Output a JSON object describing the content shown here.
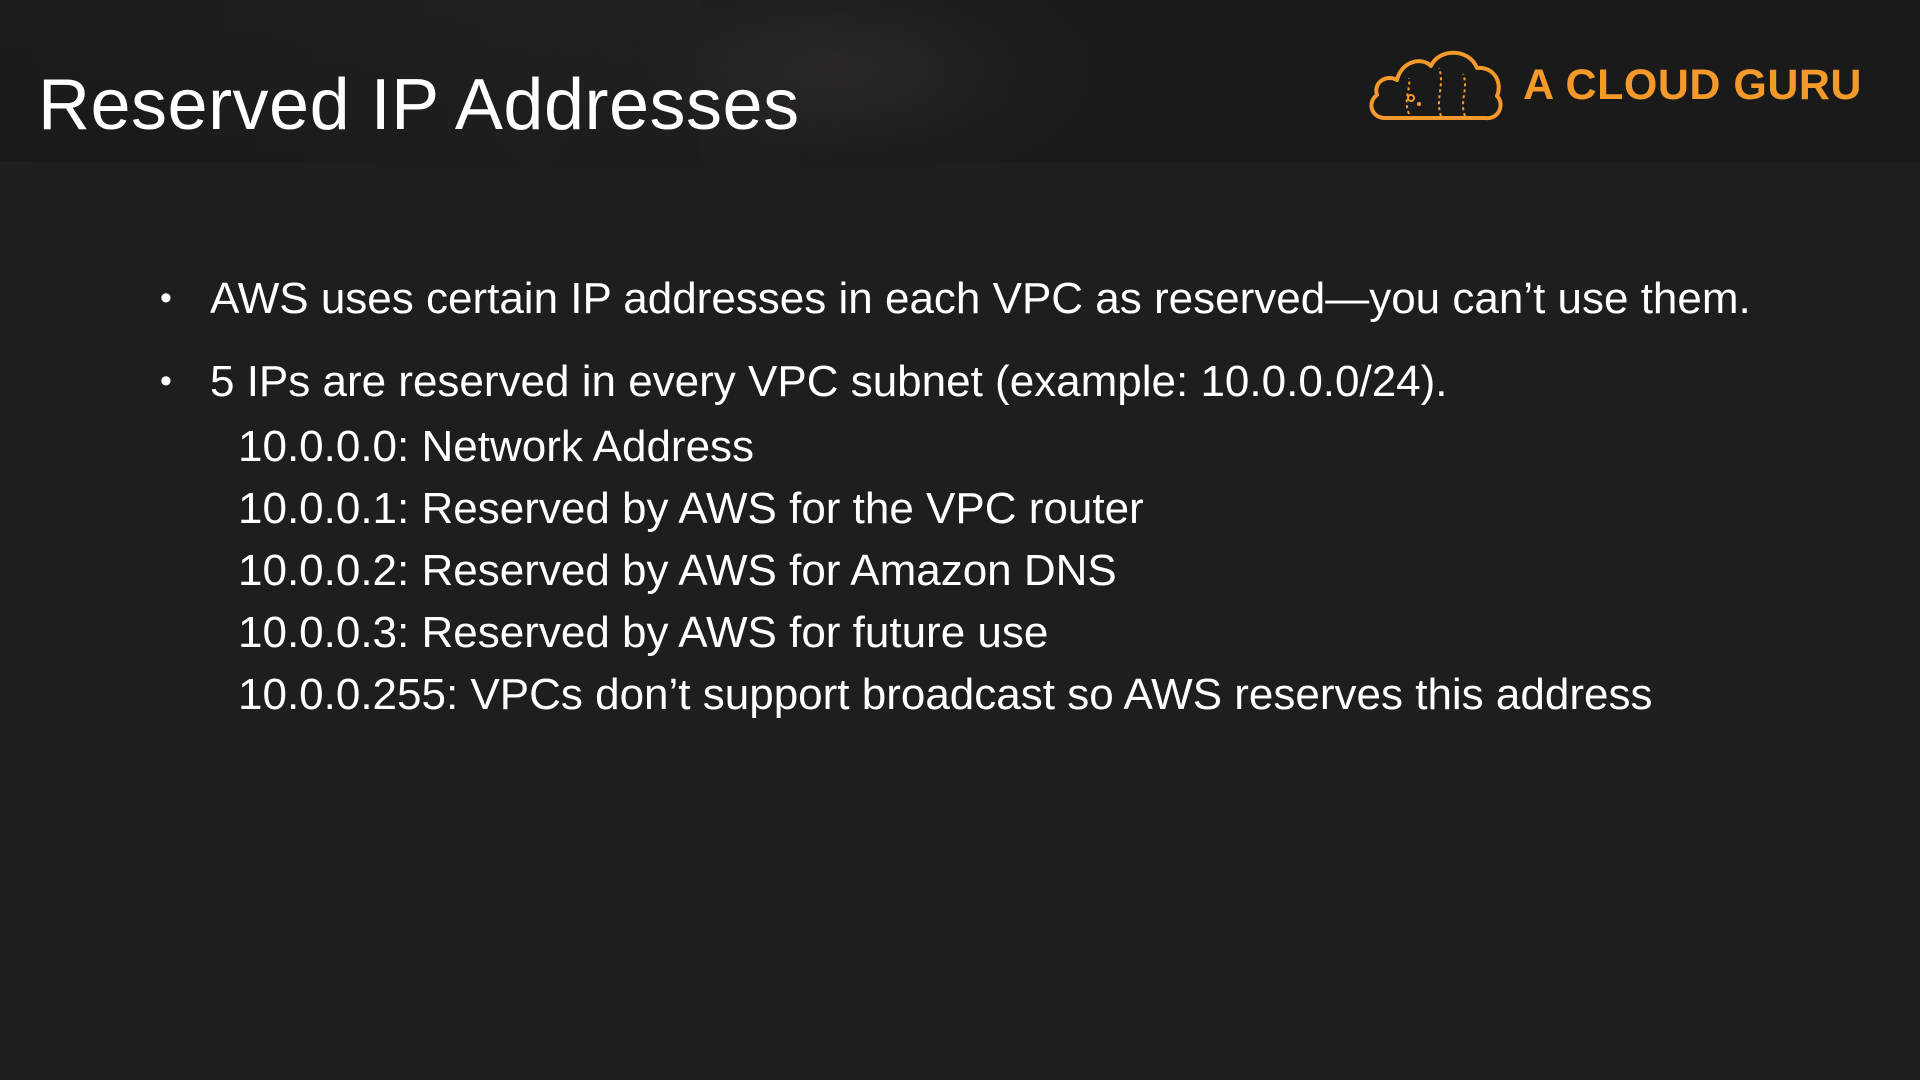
{
  "header": {
    "title": "Reserved IP Addresses",
    "brand": {
      "name": "A CLOUD GURU",
      "logo_icon": "cloud-logo-icon",
      "color": "#f39a2b"
    }
  },
  "bullets": [
    {
      "text": "AWS uses certain IP addresses in each VPC as reserved—you can’t use them.",
      "sub": []
    },
    {
      "text": "5 IPs are reserved in every VPC subnet (example: 10.0.0.0/24).",
      "sub": [
        "10.0.0.0: Network Address",
        "10.0.0.1: Reserved by AWS for the VPC router",
        "10.0.0.2: Reserved by AWS for Amazon DNS",
        "10.0.0.3: Reserved by AWS for future use",
        "10.0.0.255: VPCs don’t support broadcast so AWS reserves this address"
      ]
    }
  ],
  "colors": {
    "background": "#1e1e1e",
    "text": "#ffffff",
    "accent": "#f39a2b"
  }
}
